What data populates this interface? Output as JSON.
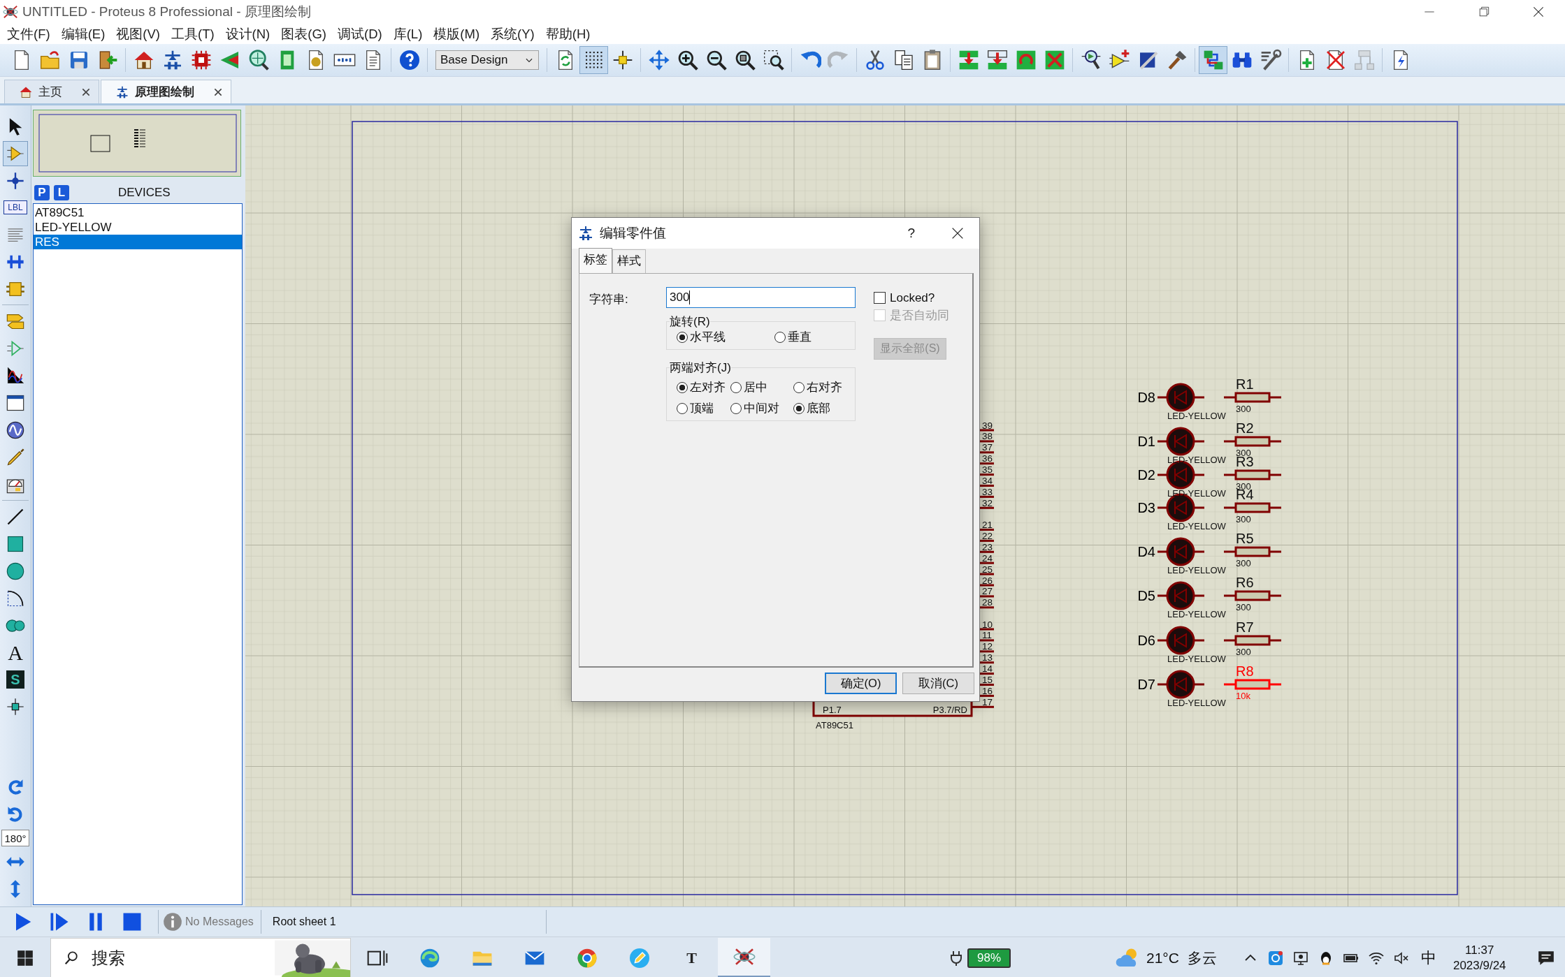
{
  "window": {
    "title": "UNTITLED - Proteus 8 Professional - 原理图绘制"
  },
  "menu": [
    "文件(F)",
    "编辑(E)",
    "视图(V)",
    "工具(T)",
    "设计(N)",
    "图表(G)",
    "调试(D)",
    "库(L)",
    "模版(M)",
    "系统(Y)",
    "帮助(H)"
  ],
  "toolbar": [
    [
      {
        "kind": "new",
        "pressed": false,
        "disabled": false
      },
      {
        "kind": "open",
        "pressed": false,
        "disabled": false
      },
      {
        "kind": "save",
        "pressed": false,
        "disabled": false
      },
      {
        "kind": "exit",
        "pressed": false,
        "disabled": false
      }
    ],
    [
      {
        "kind": "home",
        "pressed": false,
        "disabled": false
      },
      {
        "kind": "schematic",
        "pressed": false,
        "disabled": false
      },
      {
        "kind": "pcb",
        "pressed": false,
        "disabled": false
      },
      {
        "kind": "view3d",
        "pressed": false,
        "disabled": false
      },
      {
        "kind": "gerber",
        "pressed": false,
        "disabled": false
      },
      {
        "kind": "bom",
        "pressed": false,
        "disabled": false
      },
      {
        "kind": "cost",
        "pressed": false,
        "disabled": false
      },
      {
        "kind": "display",
        "pressed": false,
        "disabled": false
      },
      {
        "kind": "notes",
        "pressed": false,
        "disabled": false
      }
    ],
    [
      {
        "kind": "help",
        "pressed": false,
        "disabled": false
      }
    ],
    [
      {
        "kind": "dropdown",
        "value": "Base Design",
        "pressed": false,
        "disabled": false
      }
    ],
    [
      {
        "kind": "refresh",
        "pressed": false,
        "disabled": false
      },
      {
        "kind": "grid",
        "pressed": true,
        "disabled": false
      },
      {
        "kind": "origin",
        "pressed": false,
        "disabled": false
      }
    ],
    [
      {
        "kind": "pan",
        "pressed": false,
        "disabled": false
      },
      {
        "kind": "zoomin",
        "pressed": false,
        "disabled": false
      },
      {
        "kind": "zoomout",
        "pressed": false,
        "disabled": false
      },
      {
        "kind": "zoomall",
        "pressed": false,
        "disabled": false
      },
      {
        "kind": "zoomarea",
        "pressed": false,
        "disabled": false
      }
    ],
    [
      {
        "kind": "undo",
        "pressed": false,
        "disabled": false
      },
      {
        "kind": "redo",
        "pressed": false,
        "disabled": true
      }
    ],
    [
      {
        "kind": "cut",
        "pressed": false,
        "disabled": false
      },
      {
        "kind": "copy",
        "pressed": false,
        "disabled": false
      },
      {
        "kind": "paste",
        "pressed": false,
        "disabled": false
      }
    ],
    [
      {
        "kind": "blockcopy",
        "pressed": false,
        "disabled": false
      },
      {
        "kind": "blockmove",
        "pressed": false,
        "disabled": false
      },
      {
        "kind": "blockrotate",
        "pressed": false,
        "disabled": false
      },
      {
        "kind": "blockdelete",
        "pressed": false,
        "disabled": false
      }
    ],
    [
      {
        "kind": "pick",
        "pressed": false,
        "disabled": false
      },
      {
        "kind": "make",
        "pressed": false,
        "disabled": false
      },
      {
        "kind": "packaging",
        "pressed": false,
        "disabled": false
      },
      {
        "kind": "decompose",
        "pressed": false,
        "disabled": false
      }
    ],
    [
      {
        "kind": "autoroute",
        "pressed": true,
        "disabled": false
      },
      {
        "kind": "search",
        "pressed": false,
        "disabled": false
      },
      {
        "kind": "propassign",
        "pressed": false,
        "disabled": false
      }
    ],
    [
      {
        "kind": "newsheet",
        "pressed": false,
        "disabled": false
      },
      {
        "kind": "removesheet",
        "pressed": false,
        "disabled": false
      },
      {
        "kind": "goto",
        "pressed": false,
        "disabled": true
      }
    ],
    [
      {
        "kind": "netlist",
        "pressed": false,
        "disabled": false
      }
    ]
  ],
  "tabs": [
    {
      "label": "主页",
      "selected": false
    },
    {
      "label": "原理图绘制",
      "selected": true
    }
  ],
  "left_tools": [
    [
      {
        "kind": "select",
        "selected": false
      },
      {
        "kind": "component",
        "selected": true
      },
      {
        "kind": "junction",
        "selected": false
      },
      {
        "kind": "label",
        "glyph": "LBL",
        "selected": false
      },
      {
        "kind": "script",
        "selected": false
      },
      {
        "kind": "bus",
        "selected": false
      },
      {
        "kind": "subcircuit",
        "selected": false
      }
    ],
    [
      {
        "kind": "terminal",
        "selected": false
      },
      {
        "kind": "port",
        "selected": false
      },
      {
        "kind": "graph",
        "selected": false
      },
      {
        "kind": "tape",
        "selected": false
      },
      {
        "kind": "generator",
        "selected": false
      },
      {
        "kind": "probe",
        "selected": false
      },
      {
        "kind": "instrument",
        "selected": false
      }
    ],
    [
      {
        "kind": "line",
        "selected": false
      },
      {
        "kind": "box",
        "selected": false
      },
      {
        "kind": "circle",
        "selected": false
      },
      {
        "kind": "arc",
        "selected": false
      },
      {
        "kind": "path",
        "selected": false
      },
      {
        "kind": "text",
        "glyph": "A",
        "selected": false
      },
      {
        "kind": "symbol",
        "glyph": "S",
        "selected": false
      },
      {
        "kind": "marker",
        "selected": false
      }
    ]
  ],
  "orientation": {
    "angle": "180°"
  },
  "devices": {
    "buttons": [
      "P",
      "L"
    ],
    "title": "DEVICES",
    "items": [
      {
        "label": "AT89C51",
        "selected": false
      },
      {
        "label": "LED-YELLOW",
        "selected": false
      },
      {
        "label": "RES",
        "selected": true
      }
    ]
  },
  "schematic": {
    "chip": {
      "name": "AT89C51",
      "pin_labels": [
        "P1.7",
        "P3.7/RD"
      ],
      "pins": [
        [
          "39",
          "38",
          "37",
          "36",
          "35",
          "34",
          "33",
          "32"
        ],
        [
          "21",
          "22",
          "23",
          "24",
          "25",
          "26",
          "27",
          "28"
        ],
        [
          "10",
          "11",
          "12",
          "13",
          "14",
          "15",
          "16",
          "17"
        ]
      ]
    },
    "leds": [
      {
        "ref": "D8",
        "value": "LED-YELLOW"
      },
      {
        "ref": "D1",
        "value": "LED-YELLOW"
      },
      {
        "ref": "D2",
        "value": "LED-YELLOW"
      },
      {
        "ref": "D3",
        "value": "LED-YELLOW"
      },
      {
        "ref": "D4",
        "value": "LED-YELLOW"
      },
      {
        "ref": "D5",
        "value": "LED-YELLOW"
      },
      {
        "ref": "D6",
        "value": "LED-YELLOW"
      },
      {
        "ref": "D7",
        "value": "LED-YELLOW"
      }
    ],
    "resistors": [
      {
        "ref": "R1",
        "value": "300",
        "selected": false
      },
      {
        "ref": "R2",
        "value": "300",
        "selected": false
      },
      {
        "ref": "R3",
        "value": "300",
        "selected": false
      },
      {
        "ref": "R4",
        "value": "300",
        "selected": false
      },
      {
        "ref": "R5",
        "value": "300",
        "selected": false
      },
      {
        "ref": "R6",
        "value": "300",
        "selected": false
      },
      {
        "ref": "R7",
        "value": "300",
        "selected": false
      },
      {
        "ref": "R8",
        "value": "10k",
        "selected": true
      }
    ]
  },
  "dialog": {
    "title": "编辑零件值",
    "help": "?",
    "tabs": [
      {
        "label": "标签",
        "selected": true
      },
      {
        "label": "样式",
        "selected": false
      }
    ],
    "string_label": "字符串:",
    "string_value": "300",
    "checks": [
      {
        "label": "Locked?",
        "checked": false,
        "disabled": false
      },
      {
        "label": "是否自动同",
        "checked": false,
        "disabled": true
      }
    ],
    "show_all": {
      "label": "显示全部(S)",
      "disabled": true
    },
    "rotation": {
      "label": "旋转(R)",
      "options": [
        {
          "label": "水平线",
          "selected": true
        },
        {
          "label": "垂直",
          "selected": false
        }
      ]
    },
    "justify": {
      "label": "两端对齐(J)",
      "options": [
        {
          "label": "左对齐",
          "selected": true
        },
        {
          "label": "居中",
          "selected": false
        },
        {
          "label": "右对齐",
          "selected": false
        },
        {
          "label": "顶端",
          "selected": false
        },
        {
          "label": "中间对",
          "selected": false
        },
        {
          "label": "底部",
          "selected": true
        }
      ]
    },
    "buttons": [
      {
        "label": "确定(O)",
        "default": true
      },
      {
        "label": "取消(C)",
        "default": false
      }
    ]
  },
  "status": {
    "messages": "No Messages",
    "sheet": "Root sheet 1"
  },
  "taskbar": {
    "placeholder": "搜索",
    "apps": [
      {
        "kind": "taskview",
        "active": false
      },
      {
        "kind": "edge",
        "active": false
      },
      {
        "kind": "explorer",
        "active": false
      },
      {
        "kind": "mail",
        "active": false
      },
      {
        "kind": "chrome",
        "active": false
      },
      {
        "kind": "pencil",
        "active": false
      },
      {
        "kind": "typora",
        "glyph": "T",
        "active": false
      },
      {
        "kind": "proteus",
        "active": true
      }
    ],
    "battery": "98%",
    "temperature": "21°C",
    "weather": "多云",
    "ime": "中",
    "time": "11:37",
    "date": "2023/9/24"
  }
}
